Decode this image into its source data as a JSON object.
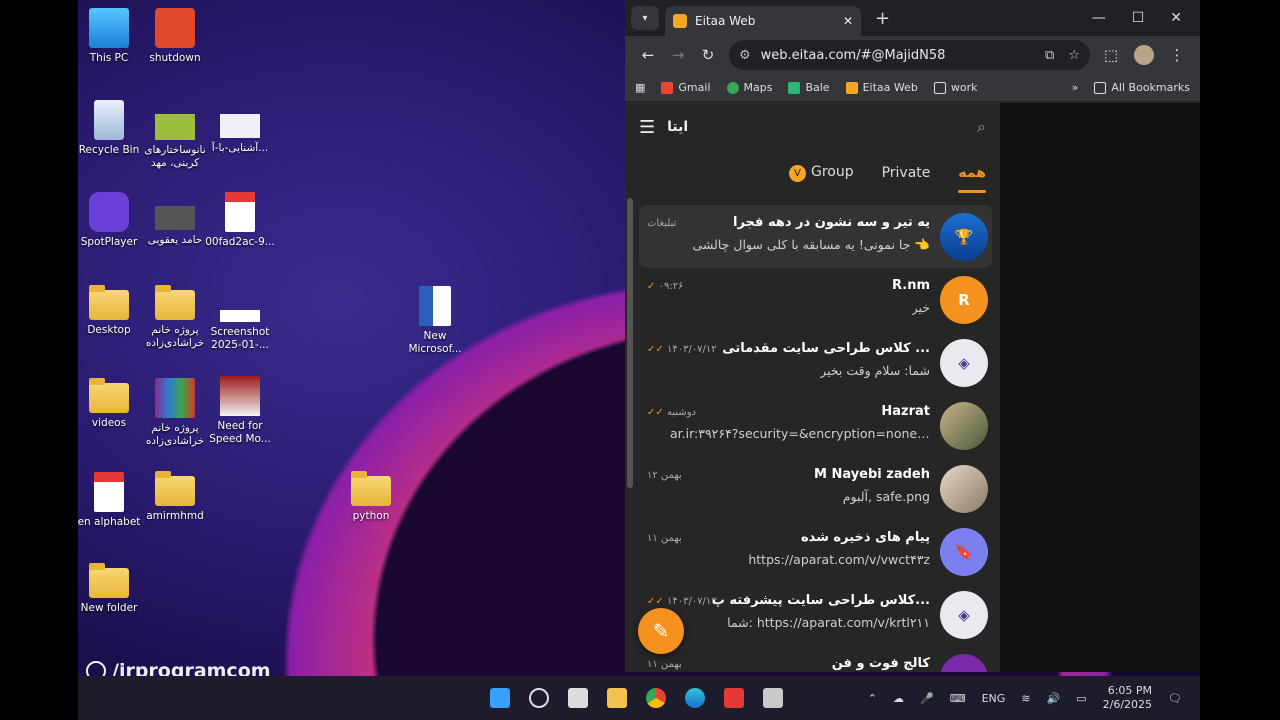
{
  "desktop": {
    "icons": [
      {
        "label": "This PC"
      },
      {
        "label": "shutdown"
      },
      {
        "label": "Recycle Bin"
      },
      {
        "label": "نانوساختارهای کربنی، مهد"
      },
      {
        "label": "آشنایی-با-آ..."
      },
      {
        "label": "SpotPlayer"
      },
      {
        "label": "حامد یعقوبی"
      },
      {
        "label": "00fad2ac-9..."
      },
      {
        "label": "Desktop"
      },
      {
        "label": "پروژه خانم خراشادی‌زاده"
      },
      {
        "label": "Screenshot 2025-01-..."
      },
      {
        "label": "New Microsof..."
      },
      {
        "label": "videos"
      },
      {
        "label": "پروژه خانم خراشادی‌زاده"
      },
      {
        "label": "Need for Speed Mo..."
      },
      {
        "label": "en alphabet"
      },
      {
        "label": "amirmhmd"
      },
      {
        "label": "python"
      },
      {
        "label": "New folder"
      }
    ],
    "watermark": "/irprogramcom"
  },
  "browser": {
    "tab_title": "Eitaa Web",
    "url": "web.eitaa.com/#@MajidN58",
    "bookmarks": [
      "Gmail",
      "Maps",
      "Bale",
      "Eitaa Web",
      "work"
    ],
    "all_bookmarks": "All Bookmarks"
  },
  "app": {
    "name": "ایتا",
    "tabs": {
      "all": "همه",
      "private": "Private",
      "group": "Group"
    },
    "chats": [
      {
        "name": "یه تیر و سه نشون در دهه فجرا",
        "msg": "جا نمونی! یه مسابقه با کلی سوال چالشی 👈",
        "meta": "تبلیغات",
        "avatar": "🏆"
      },
      {
        "name": "R.nm",
        "msg": "خیر",
        "meta": "۰۹:۲۶",
        "avatar": "R"
      },
      {
        "name": "کلاس طراحی سایت مقدماتی ...",
        "msg": "شما: سلام وقت بخیر",
        "meta": "۱۴۰۳/۰۷/۱۲",
        "avatar": "◈"
      },
      {
        "name": "Hazrat",
        "msg": "ar.ir:۳۹۲۶۴?security=&encryption=none&h...",
        "meta": "دوشنبه",
        "avatar": ""
      },
      {
        "name": "M Nayebi zadeh",
        "msg": "آلبوم, safe.png",
        "meta": "۱۲ بهمن",
        "avatar": ""
      },
      {
        "name": "پیام های ذخیره شده",
        "msg": "https://aparat.com/v/vwct۴۳z",
        "meta": "۱۱ بهمن",
        "avatar": "🔖"
      },
      {
        "name": "کلاس طراحی سایت پیشرفته پ...",
        "msg": "شما: https://aparat.com/v/krtl۲۱۱",
        "meta": "۱۴۰۳/۰۷/۱۳",
        "avatar": "◈"
      },
      {
        "name": "کالج فوت و فن",
        "msg": "",
        "meta": "۱۱ بهمن",
        "avatar": ""
      }
    ],
    "colors": {
      "accent": "#f6901e",
      "bg": "#262626"
    }
  },
  "taskbar": {
    "lang": "ENG",
    "time": "6:05 PM",
    "date": "2/6/2025"
  }
}
